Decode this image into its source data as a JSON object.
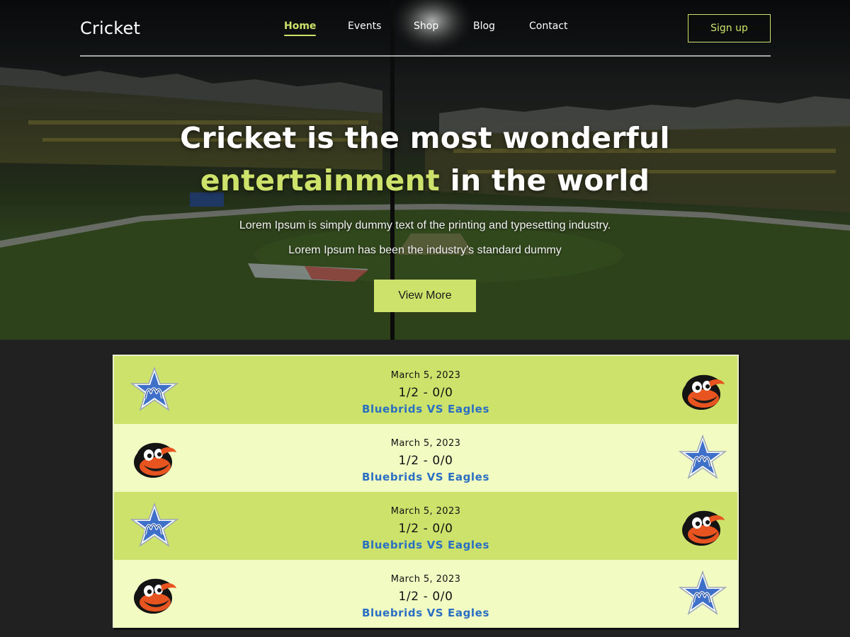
{
  "nav": {
    "brand": "Cricket",
    "links": [
      {
        "label": "Home",
        "active": true
      },
      {
        "label": "Events",
        "active": false
      },
      {
        "label": "Shop",
        "active": false
      },
      {
        "label": "Blog",
        "active": false
      },
      {
        "label": "Contact",
        "active": false
      }
    ],
    "signup_label": "Sign up"
  },
  "hero": {
    "headline_line1": "Cricket is the most wonderful",
    "headline_accent": "entertainment",
    "headline_line2_rest": " in the world",
    "subtext_line1": "Lorem Ipsum is simply dummy text of the printing and typesetting industry.",
    "subtext_line2": "Lorem Ipsum has been the industry's standard dummy",
    "cta_label": "View More"
  },
  "matches": [
    {
      "date": "March 5, 2023",
      "score": "1/2 - 0/0",
      "teams": "Bluebrids VS Eagles",
      "left_logo": "star-team-logo",
      "right_logo": "bird-team-logo",
      "style": "dark"
    },
    {
      "date": "March 5, 2023",
      "score": "1/2 - 0/0",
      "teams": "Bluebrids VS Eagles",
      "left_logo": "bird-team-logo",
      "right_logo": "star-team-logo",
      "style": "light"
    },
    {
      "date": "March 5, 2023",
      "score": "1/2 - 0/0",
      "teams": "Bluebrids VS Eagles",
      "left_logo": "star-team-logo",
      "right_logo": "bird-team-logo",
      "style": "dark"
    },
    {
      "date": "March 5, 2023",
      "score": "1/2 - 0/0",
      "teams": "Bluebrids VS Eagles",
      "left_logo": "bird-team-logo",
      "right_logo": "star-team-logo",
      "style": "light"
    }
  ],
  "colors": {
    "accent": "#cde26a",
    "row_light": "#f2fcc2",
    "team_text": "#2a6fc2",
    "page_bg": "#212121"
  }
}
